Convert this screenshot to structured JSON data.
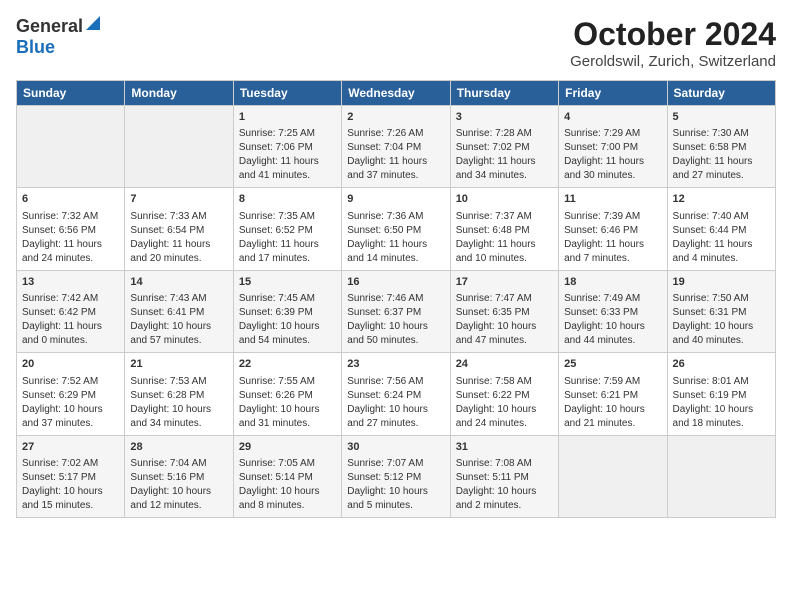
{
  "header": {
    "logo_general": "General",
    "logo_blue": "Blue",
    "title": "October 2024",
    "location": "Geroldswil, Zurich, Switzerland"
  },
  "days_of_week": [
    "Sunday",
    "Monday",
    "Tuesday",
    "Wednesday",
    "Thursday",
    "Friday",
    "Saturday"
  ],
  "weeks": [
    [
      {
        "day": "",
        "content": ""
      },
      {
        "day": "",
        "content": ""
      },
      {
        "day": "1",
        "content": "Sunrise: 7:25 AM\nSunset: 7:06 PM\nDaylight: 11 hours and 41 minutes."
      },
      {
        "day": "2",
        "content": "Sunrise: 7:26 AM\nSunset: 7:04 PM\nDaylight: 11 hours and 37 minutes."
      },
      {
        "day": "3",
        "content": "Sunrise: 7:28 AM\nSunset: 7:02 PM\nDaylight: 11 hours and 34 minutes."
      },
      {
        "day": "4",
        "content": "Sunrise: 7:29 AM\nSunset: 7:00 PM\nDaylight: 11 hours and 30 minutes."
      },
      {
        "day": "5",
        "content": "Sunrise: 7:30 AM\nSunset: 6:58 PM\nDaylight: 11 hours and 27 minutes."
      }
    ],
    [
      {
        "day": "6",
        "content": "Sunrise: 7:32 AM\nSunset: 6:56 PM\nDaylight: 11 hours and 24 minutes."
      },
      {
        "day": "7",
        "content": "Sunrise: 7:33 AM\nSunset: 6:54 PM\nDaylight: 11 hours and 20 minutes."
      },
      {
        "day": "8",
        "content": "Sunrise: 7:35 AM\nSunset: 6:52 PM\nDaylight: 11 hours and 17 minutes."
      },
      {
        "day": "9",
        "content": "Sunrise: 7:36 AM\nSunset: 6:50 PM\nDaylight: 11 hours and 14 minutes."
      },
      {
        "day": "10",
        "content": "Sunrise: 7:37 AM\nSunset: 6:48 PM\nDaylight: 11 hours and 10 minutes."
      },
      {
        "day": "11",
        "content": "Sunrise: 7:39 AM\nSunset: 6:46 PM\nDaylight: 11 hours and 7 minutes."
      },
      {
        "day": "12",
        "content": "Sunrise: 7:40 AM\nSunset: 6:44 PM\nDaylight: 11 hours and 4 minutes."
      }
    ],
    [
      {
        "day": "13",
        "content": "Sunrise: 7:42 AM\nSunset: 6:42 PM\nDaylight: 11 hours and 0 minutes."
      },
      {
        "day": "14",
        "content": "Sunrise: 7:43 AM\nSunset: 6:41 PM\nDaylight: 10 hours and 57 minutes."
      },
      {
        "day": "15",
        "content": "Sunrise: 7:45 AM\nSunset: 6:39 PM\nDaylight: 10 hours and 54 minutes."
      },
      {
        "day": "16",
        "content": "Sunrise: 7:46 AM\nSunset: 6:37 PM\nDaylight: 10 hours and 50 minutes."
      },
      {
        "day": "17",
        "content": "Sunrise: 7:47 AM\nSunset: 6:35 PM\nDaylight: 10 hours and 47 minutes."
      },
      {
        "day": "18",
        "content": "Sunrise: 7:49 AM\nSunset: 6:33 PM\nDaylight: 10 hours and 44 minutes."
      },
      {
        "day": "19",
        "content": "Sunrise: 7:50 AM\nSunset: 6:31 PM\nDaylight: 10 hours and 40 minutes."
      }
    ],
    [
      {
        "day": "20",
        "content": "Sunrise: 7:52 AM\nSunset: 6:29 PM\nDaylight: 10 hours and 37 minutes."
      },
      {
        "day": "21",
        "content": "Sunrise: 7:53 AM\nSunset: 6:28 PM\nDaylight: 10 hours and 34 minutes."
      },
      {
        "day": "22",
        "content": "Sunrise: 7:55 AM\nSunset: 6:26 PM\nDaylight: 10 hours and 31 minutes."
      },
      {
        "day": "23",
        "content": "Sunrise: 7:56 AM\nSunset: 6:24 PM\nDaylight: 10 hours and 27 minutes."
      },
      {
        "day": "24",
        "content": "Sunrise: 7:58 AM\nSunset: 6:22 PM\nDaylight: 10 hours and 24 minutes."
      },
      {
        "day": "25",
        "content": "Sunrise: 7:59 AM\nSunset: 6:21 PM\nDaylight: 10 hours and 21 minutes."
      },
      {
        "day": "26",
        "content": "Sunrise: 8:01 AM\nSunset: 6:19 PM\nDaylight: 10 hours and 18 minutes."
      }
    ],
    [
      {
        "day": "27",
        "content": "Sunrise: 7:02 AM\nSunset: 5:17 PM\nDaylight: 10 hours and 15 minutes."
      },
      {
        "day": "28",
        "content": "Sunrise: 7:04 AM\nSunset: 5:16 PM\nDaylight: 10 hours and 12 minutes."
      },
      {
        "day": "29",
        "content": "Sunrise: 7:05 AM\nSunset: 5:14 PM\nDaylight: 10 hours and 8 minutes."
      },
      {
        "day": "30",
        "content": "Sunrise: 7:07 AM\nSunset: 5:12 PM\nDaylight: 10 hours and 5 minutes."
      },
      {
        "day": "31",
        "content": "Sunrise: 7:08 AM\nSunset: 5:11 PM\nDaylight: 10 hours and 2 minutes."
      },
      {
        "day": "",
        "content": ""
      },
      {
        "day": "",
        "content": ""
      }
    ]
  ]
}
